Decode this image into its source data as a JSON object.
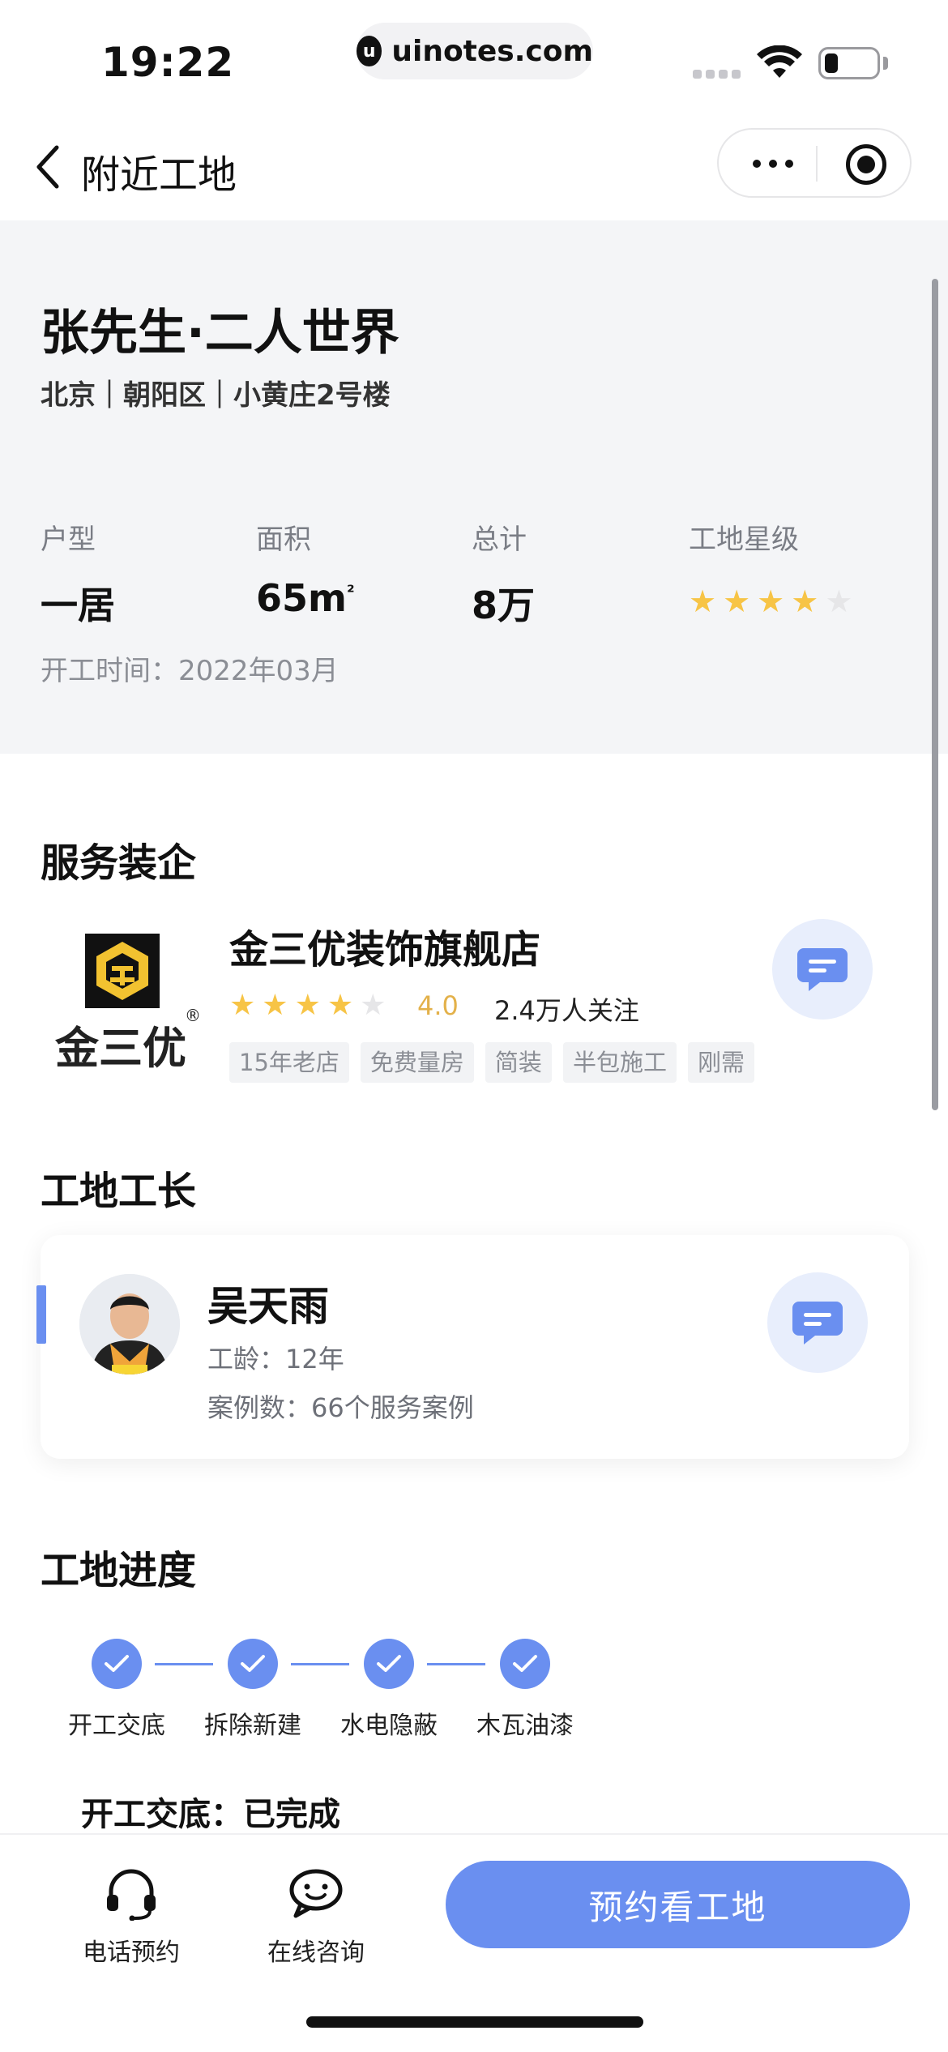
{
  "status_bar": {
    "time": "19:22",
    "url": "uinotes.com",
    "url_icon_letter": "u"
  },
  "nav": {
    "title": "附近工地"
  },
  "site": {
    "title": "张先生·二人世界",
    "address": "北京｜朝阳区｜小黄庄2号楼",
    "stats": [
      {
        "label": "户型",
        "value": "一居"
      },
      {
        "label": "面积",
        "value": "65m",
        "unit_sup": "²"
      },
      {
        "label": "总计",
        "value": "8万"
      },
      {
        "label": "工地星级",
        "stars_filled": 4,
        "stars_total": 5
      }
    ],
    "start_date": "开工时间：2022年03月"
  },
  "company_section": {
    "title": "服务装企",
    "company": {
      "name": "金三优装饰旗舰店",
      "logo_text": "金三优",
      "rating": "4.0",
      "rating_stars_filled": 4,
      "rating_stars_total": 5,
      "followers": "2.4万人关注",
      "tags": [
        "15年老店",
        "免费量房",
        "简装",
        "半包施工",
        "刚需"
      ]
    }
  },
  "foreman_section": {
    "title": "工地工长",
    "foreman": {
      "name": "吴天雨",
      "experience": "工龄：12年",
      "cases": "案例数：66个服务案例"
    }
  },
  "progress_section": {
    "title": "工地进度",
    "steps": [
      {
        "label": "开工交底",
        "done": true
      },
      {
        "label": "拆除新建",
        "done": true
      },
      {
        "label": "水电隐蔽",
        "done": true
      },
      {
        "label": "木瓦油漆",
        "done": true
      }
    ],
    "current_status": "开工交底：已完成"
  },
  "bottom_bar": {
    "phone_label": "电话预约",
    "chat_label": "在线咨询",
    "book_label": "预约看工地"
  },
  "colors": {
    "accent": "#6a8ff0",
    "star": "#f7c446",
    "hero_bg": "#f4f5f7"
  }
}
